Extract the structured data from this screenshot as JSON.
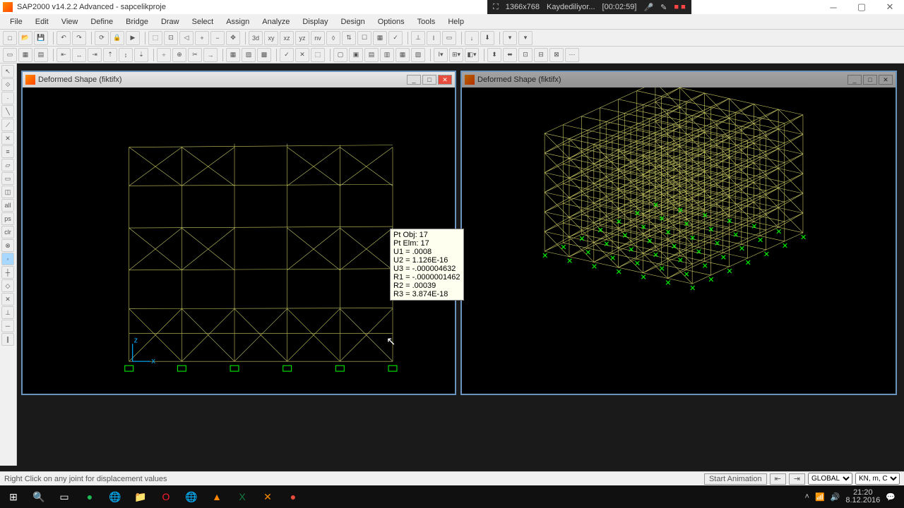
{
  "app": {
    "title": "SAP2000 v14.2.2 Advanced  -  sapcelikproje"
  },
  "recorder": {
    "res": "1366x768",
    "status": "Kaydediliyor...",
    "time": "[00:02:59]"
  },
  "menu": [
    "File",
    "Edit",
    "View",
    "Define",
    "Bridge",
    "Draw",
    "Select",
    "Assign",
    "Analyze",
    "Display",
    "Design",
    "Options",
    "Tools",
    "Help"
  ],
  "mdi": {
    "left_title": "Deformed Shape (fiktifx)",
    "right_title": "Deformed Shape (fiktifx)"
  },
  "tooltip": {
    "l1": "Pt Obj: 17",
    "l2": "Pt Elm: 17",
    "l3": "U1 =   .0008",
    "l4": "U2 =  1.126E-16",
    "l5": "U3 =  -.000004632",
    "l6": "R1 =  -.0000001462",
    "l7": "R2 =   .00039",
    "l8": "R3 =  3.874E-18"
  },
  "status": {
    "hint": "Right Click on any joint for displacement values",
    "anim": "Start Animation",
    "coord": "GLOBAL",
    "units": "KN, m, C"
  },
  "tray": {
    "time": "21:20",
    "date": "8.12.2016"
  }
}
